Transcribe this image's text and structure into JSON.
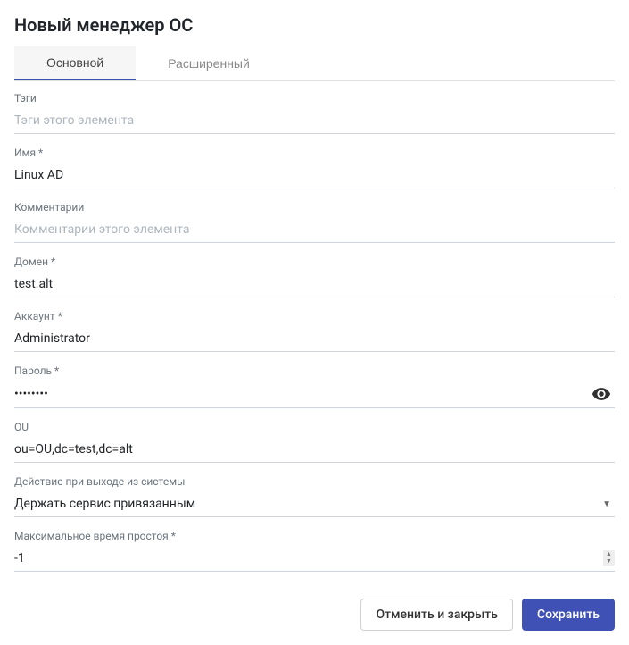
{
  "title": "Новый менеджер ОС",
  "tabs": {
    "main": "Основной",
    "advanced": "Расширенный"
  },
  "labels": {
    "tags": "Тэги",
    "name": "Имя *",
    "comments": "Комментарии",
    "domain": "Домен *",
    "account": "Аккаунт *",
    "password": "Пароль *",
    "ou": "OU",
    "logout_action": "Действие при выходе из системы",
    "max_idle": "Максимальное время простоя *"
  },
  "placeholders": {
    "tags": "Тэги этого элемента",
    "comments": "Комментарии этого элемента"
  },
  "values": {
    "name": "Linux AD",
    "domain": "test.alt",
    "account": "Administrator",
    "password": "••••••••",
    "ou": "ou=OU,dc=test,dc=alt",
    "logout_action": "Держать сервис привязанным",
    "max_idle": "-1"
  },
  "buttons": {
    "cancel": "Отменить и закрыть",
    "save": "Сохранить"
  }
}
